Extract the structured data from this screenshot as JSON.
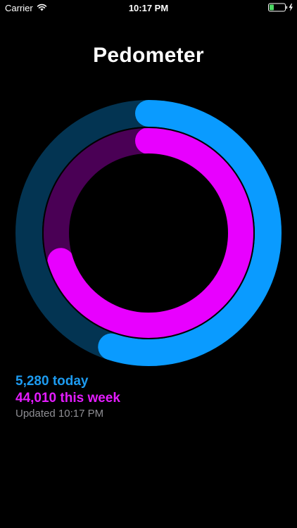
{
  "status_bar": {
    "carrier": "Carrier",
    "time": "10:17 PM",
    "wifi_icon": "wifi-icon",
    "battery_icon": "battery-charging-icon"
  },
  "title": "Pedometer",
  "rings": {
    "outer": {
      "color": "#0a9bff",
      "track_color": "#033452",
      "progress": 0.55
    },
    "inner": {
      "color": "#e800ff",
      "track_color": "#4a0055",
      "progress": 0.7
    }
  },
  "stats": {
    "today": "5,280 today",
    "week": "44,010 this week",
    "updated": "Updated 10:17 PM"
  },
  "colors": {
    "today": "#1d9bf0",
    "week": "#e41cff",
    "updated": "#8e8e93"
  }
}
